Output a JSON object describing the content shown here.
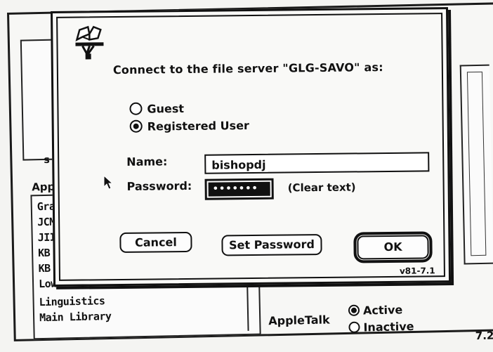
{
  "chooser": {
    "pane_letter": "s",
    "section_label": "Appl",
    "zone_list": [
      "Gra",
      "JCM",
      "JIIG",
      "KB (",
      "KB S",
      "Low",
      "Linguistics",
      "Main Library"
    ],
    "appletalk": {
      "label": "AppleTalk",
      "active_label": "Active",
      "inactive_label": "Inactive",
      "selected": "Active"
    },
    "version": "7.2"
  },
  "dialog": {
    "icon": "file-server-icon",
    "prompt": "Connect to the file server \"GLG-SAVO\" as:",
    "options": [
      {
        "label": "Guest",
        "selected": false
      },
      {
        "label": "Registered User",
        "selected": true
      }
    ],
    "name_label": "Name:",
    "name_value": "bishopdj",
    "password_label": "Password:",
    "password_mask": "•••••••",
    "password_mode": "(Clear text)",
    "buttons": {
      "cancel": "Cancel",
      "set_password": "Set Password",
      "ok": "OK"
    },
    "version": "v81-7.1"
  }
}
